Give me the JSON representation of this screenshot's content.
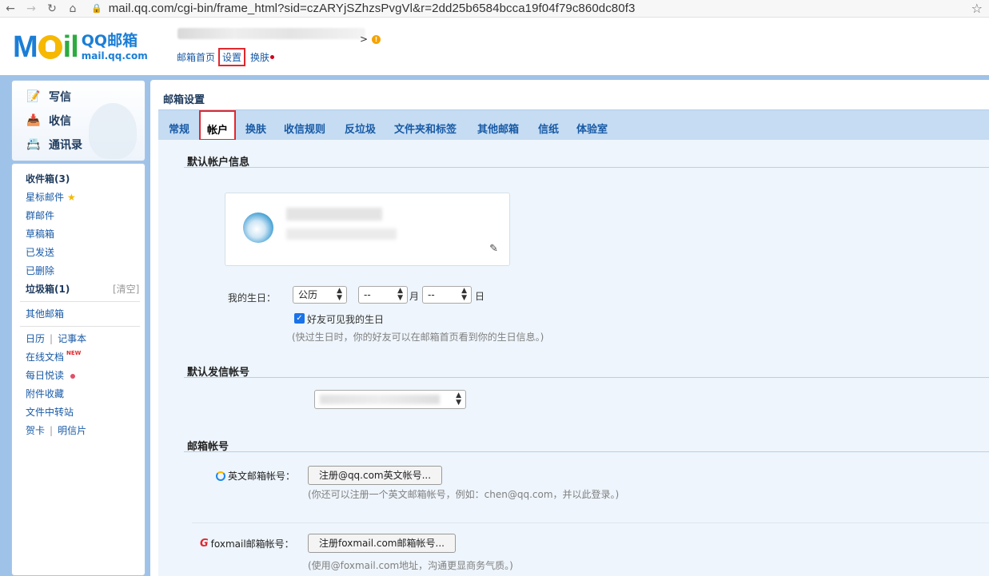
{
  "browser": {
    "back_icon": "arrow-left-icon",
    "url": "mail.qq.com/cgi-bin/frame_html?sid=czARYjSZhzsPvgVl&r=2dd25b6584bcca19f04f79c860dc80f3"
  },
  "header": {
    "logo_mail": "M",
    "logo_il": "il",
    "logo_cn": "QQ邮箱",
    "logo_domain": "mail.qq.com",
    "user_caret": ">",
    "warning_symbol": "!",
    "links": {
      "home": "邮箱首页",
      "sep": "|",
      "settings": "设置",
      "skin": "换肤"
    }
  },
  "sidebar": {
    "actions": [
      {
        "label": "写信",
        "icon": "compose-icon"
      },
      {
        "label": "收信",
        "icon": "inbox-download-icon"
      },
      {
        "label": "通讯录",
        "icon": "contacts-icon"
      }
    ],
    "folders": {
      "inbox": "收件箱(3)",
      "starred": "星标邮件",
      "group": "群邮件",
      "drafts": "草稿箱",
      "sent": "已发送",
      "deleted": "已删除",
      "spam": "垃圾箱(1)",
      "clear": "[清空]",
      "other_mailbox": "其他邮箱",
      "calendar": "日历",
      "notes": "记事本",
      "online_docs": "在线文档",
      "new_tag": "NEW",
      "daily_reading": "每日悦读",
      "attachments": "附件收藏",
      "file_transfer": "文件中转站",
      "cards": "贺卡",
      "postcards": "明信片",
      "pipe": "|"
    }
  },
  "main": {
    "title": "邮箱设置",
    "tabs": [
      "常规",
      "帐户",
      "换肤",
      "收信规则",
      "反垃圾",
      "文件夹和标签",
      "其他邮箱",
      "信纸",
      "体验室"
    ],
    "active_tab_index": 1,
    "section_default_account": "默认帐户信息",
    "birthday_label": "我的生日：",
    "calendar_value": "公历",
    "month_value": "--",
    "month_unit": "月",
    "day_value": "--",
    "day_unit": "日",
    "friends_visible_label": "好友可见我的生日",
    "friends_visible_checked": true,
    "birthday_hint": "(快过生日时，你的好友可以在邮箱首页看到你的生日信息。)",
    "section_default_sender": "默认发信帐号",
    "section_mail_accounts": "邮箱帐号",
    "english_account_label": "英文邮箱帐号：",
    "english_account_button": "注册@qq.com英文帐号...",
    "english_account_hint": "(你还可以注册一个英文邮箱帐号，例如：chen@qq.com，并以此登录。)",
    "foxmail_account_label": "foxmail邮箱帐号：",
    "foxmail_account_button": "注册foxmail.com邮箱帐号...",
    "foxmail_account_hint": "(使用@foxmail.com地址，沟通更显商务气质。)"
  },
  "colors": {
    "frame_blue": "#9fc2e8",
    "tab_bar": "#c5dcf2",
    "link_blue": "#185aa6",
    "highlight_red": "#e0282e"
  }
}
